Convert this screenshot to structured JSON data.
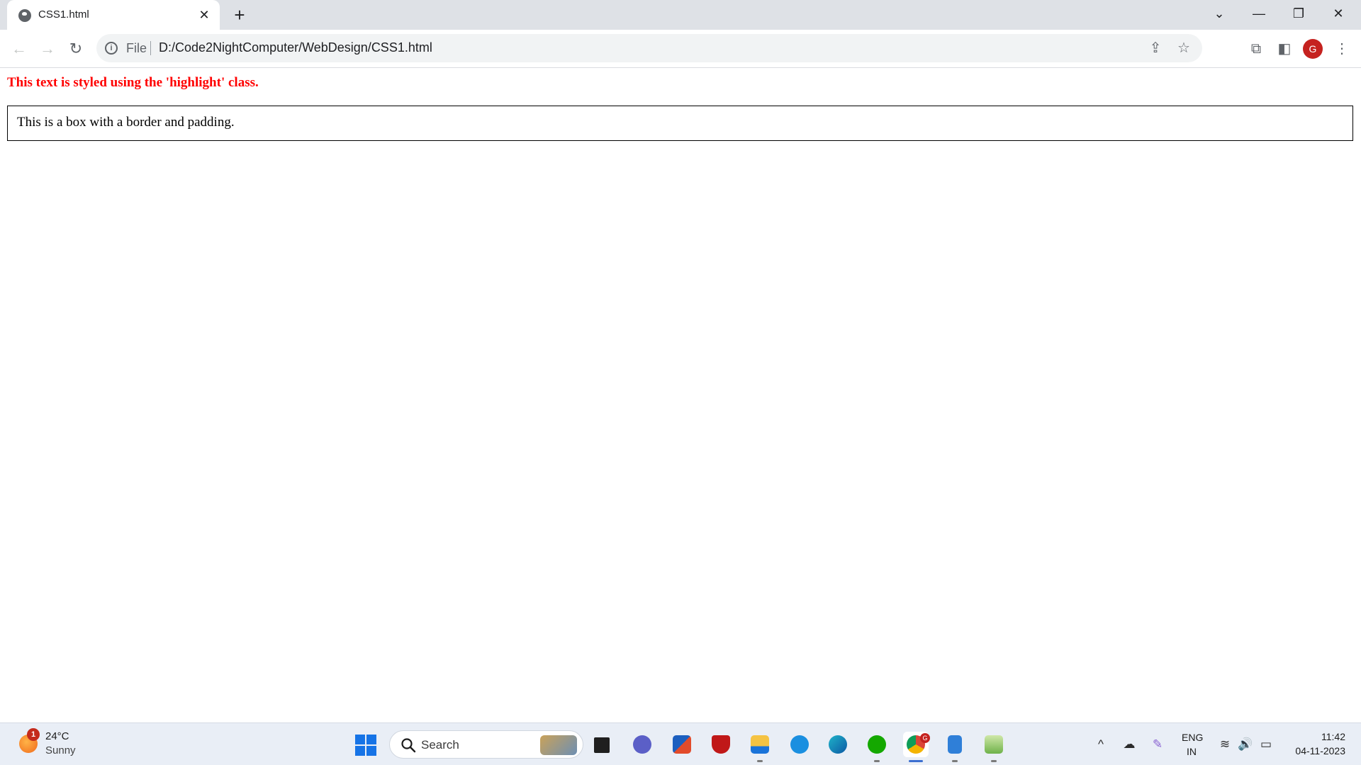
{
  "browser": {
    "tab": {
      "title": "CSS1.html",
      "close_glyph": "✕"
    },
    "new_tab_glyph": "+",
    "window_controls": {
      "tab_search": "⌄",
      "minimize": "—",
      "restore": "❐",
      "close": "✕"
    },
    "nav": {
      "back": "←",
      "forward": "→",
      "reload": "↻"
    },
    "omnibox": {
      "scheme_label": "File",
      "url": "D:/Code2NightComputer/WebDesign/CSS1.html",
      "share_glyph": "⇪",
      "bookmark_glyph": "☆"
    },
    "toolbar": {
      "extensions_glyph": "⧉",
      "side_panel_glyph": "◧",
      "profile_initial": "G",
      "menu_glyph": "⋮"
    }
  },
  "page": {
    "highlight_text": "This text is styled using the 'highlight' class.",
    "box_text": "This is a box with a border and padding.",
    "highlight_color": "#ff0000"
  },
  "taskbar": {
    "weather": {
      "badge": "1",
      "temperature": "24°C",
      "condition": "Sunny"
    },
    "search_placeholder": "Search",
    "apps": [
      "File Explorer task view",
      "Teams",
      "Microsoft Store",
      "McAfee",
      "File Explorer",
      "Get Help",
      "Microsoft Edge",
      "Upwork",
      "Google Chrome",
      "Notepad",
      "Notepad++"
    ],
    "chrome_badge": "G",
    "tray": {
      "chevron": "^",
      "cloud": "☁",
      "pen": "✎",
      "wifi": "≋",
      "volume": "🔊",
      "battery": "▭"
    },
    "language": {
      "line1": "ENG",
      "line2": "IN"
    },
    "clock": {
      "time": "11:42",
      "date": "04-11-2023"
    }
  }
}
